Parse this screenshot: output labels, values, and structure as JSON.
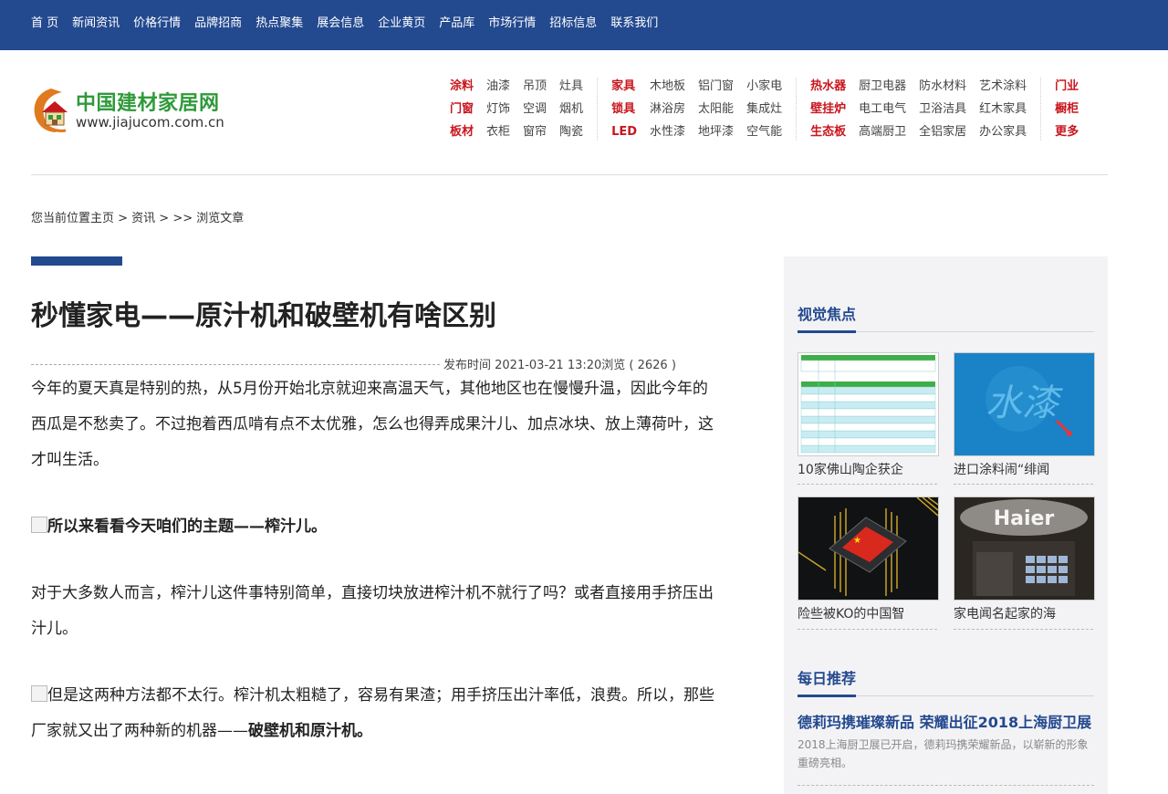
{
  "topnav": [
    "首 页",
    "新闻资讯",
    "价格行情",
    "品牌招商",
    "热点聚集",
    "展会信息",
    "企业黄页",
    "产品库",
    "市场行情",
    "招标信息",
    "联系我们"
  ],
  "logo": {
    "name": "中国建材家居网",
    "url": "www.jiajucom.com.cn"
  },
  "categories": [
    {
      "rows": [
        [
          "涂料",
          "油漆",
          "吊顶",
          "灶具"
        ],
        [
          "门窗",
          "灯饰",
          "空调",
          "烟机"
        ],
        [
          "板材",
          "衣柜",
          "窗帘",
          "陶瓷"
        ]
      ]
    },
    {
      "rows": [
        [
          "家具",
          "木地板",
          "铝门窗",
          "小家电"
        ],
        [
          "锁具",
          "淋浴房",
          "太阳能",
          "集成灶"
        ],
        [
          "LED",
          "水性漆",
          "地坪漆",
          "空气能"
        ]
      ]
    },
    {
      "rows": [
        [
          "热水器",
          "厨卫电器",
          "防水材料",
          "艺术涂料"
        ],
        [
          "壁挂炉",
          "电工电气",
          "卫浴洁具",
          "红木家具"
        ],
        [
          "生态板",
          "高端厨卫",
          "全铝家居",
          "办公家具"
        ]
      ]
    },
    {
      "rows": [
        [
          "门业"
        ],
        [
          "橱柜"
        ],
        [
          "更多"
        ]
      ]
    }
  ],
  "breadcrumb": "您当前位置主页 > 资讯 > >> 浏览文章",
  "article": {
    "title": "秒懂家电——原汁机和破壁机有啥区别",
    "meta": "发布时间 2021-03-21 13:20浏览 ( 2626 )",
    "p1": "今年的夏天真是特别的热，从5月份开始北京就迎来高温天气，其他地区也在慢慢升温，因此今年的西瓜是不愁卖了。不过抱着西瓜啃有点不太优雅，怎么也得弄成果汁儿、加点冰块、放上薄荷叶，这才叫生活。",
    "p2": "所以来看看今天咱们的主题——榨汁儿。",
    "p3": "对于大多数人而言，榨汁儿这件事特别简单，直接切块放进榨汁机不就行了吗？或者直接用手挤压出汁儿。",
    "p4a": "但是这两种方法都不太行。榨汁机太粗糙了，容易有果渣；用手挤压出汁率低，浪费。所以，那些厂家就又出了两种新的机器——",
    "p4b": "破壁机和原汁机。"
  },
  "sidebar": {
    "focus_title": "视觉焦点",
    "focus_items": [
      "10家佛山陶企获企",
      "进口涂料闹“绯闻",
      "险些被KO的中国智",
      "家电闻名起家的海"
    ],
    "daily_title": "每日推荐",
    "rec_title": "德莉玛携璀璨新品 荣耀出征2018上海厨卫展",
    "rec_desc": "2018上海厨卫展已开启，德莉玛携荣耀新品，以崭新的形象重磅亮相。",
    "thumb_text": {
      "water": "水漆",
      "haier": "Haier"
    }
  },
  "colors": {
    "brand": "#23498f",
    "hot": "#c8161d",
    "logo_green": "#2f9a3a"
  }
}
